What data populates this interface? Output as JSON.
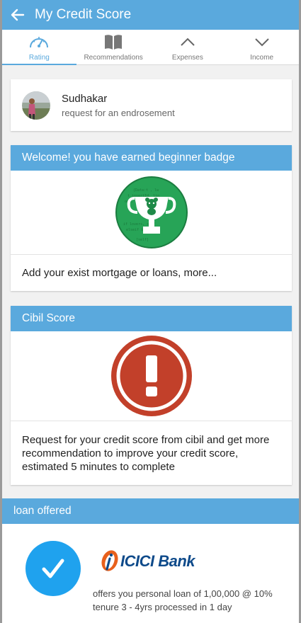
{
  "appbar": {
    "title": "My Credit Score"
  },
  "tabs": [
    {
      "label": "Rating",
      "icon": "gauge-icon",
      "active": true
    },
    {
      "label": "Recommendations",
      "icon": "book-icon",
      "active": false
    },
    {
      "label": "Expenses",
      "icon": "chevron-up-icon",
      "active": false
    },
    {
      "label": "Income",
      "icon": "chevron-down-icon",
      "active": false
    }
  ],
  "endorsement": {
    "name": "Sudhakar",
    "message": "request for an endrosement"
  },
  "badge_card": {
    "header": "Welcome! you have earned beginner badge",
    "text": "Add your exist mortgage or loans, more..."
  },
  "cibil_card": {
    "header": "Cibil Score",
    "text": "Request for your credit score from cibil and get more recommendation to improve your credit score, estimated 5 minutes to complete"
  },
  "loan": {
    "header": "loan offered",
    "bank_name": "ICICI Bank",
    "description": "offers you personal loan of 1,00,000 @ 10% tenure 3 - 4yrs processed in 1 day"
  },
  "colors": {
    "primary": "#5aa9dd",
    "badge_green": "#27a457",
    "alert_red": "#c2402a",
    "check_blue": "#1fa2ee",
    "icici_orange": "#e8601c",
    "icici_blue": "#0e4a8a"
  }
}
